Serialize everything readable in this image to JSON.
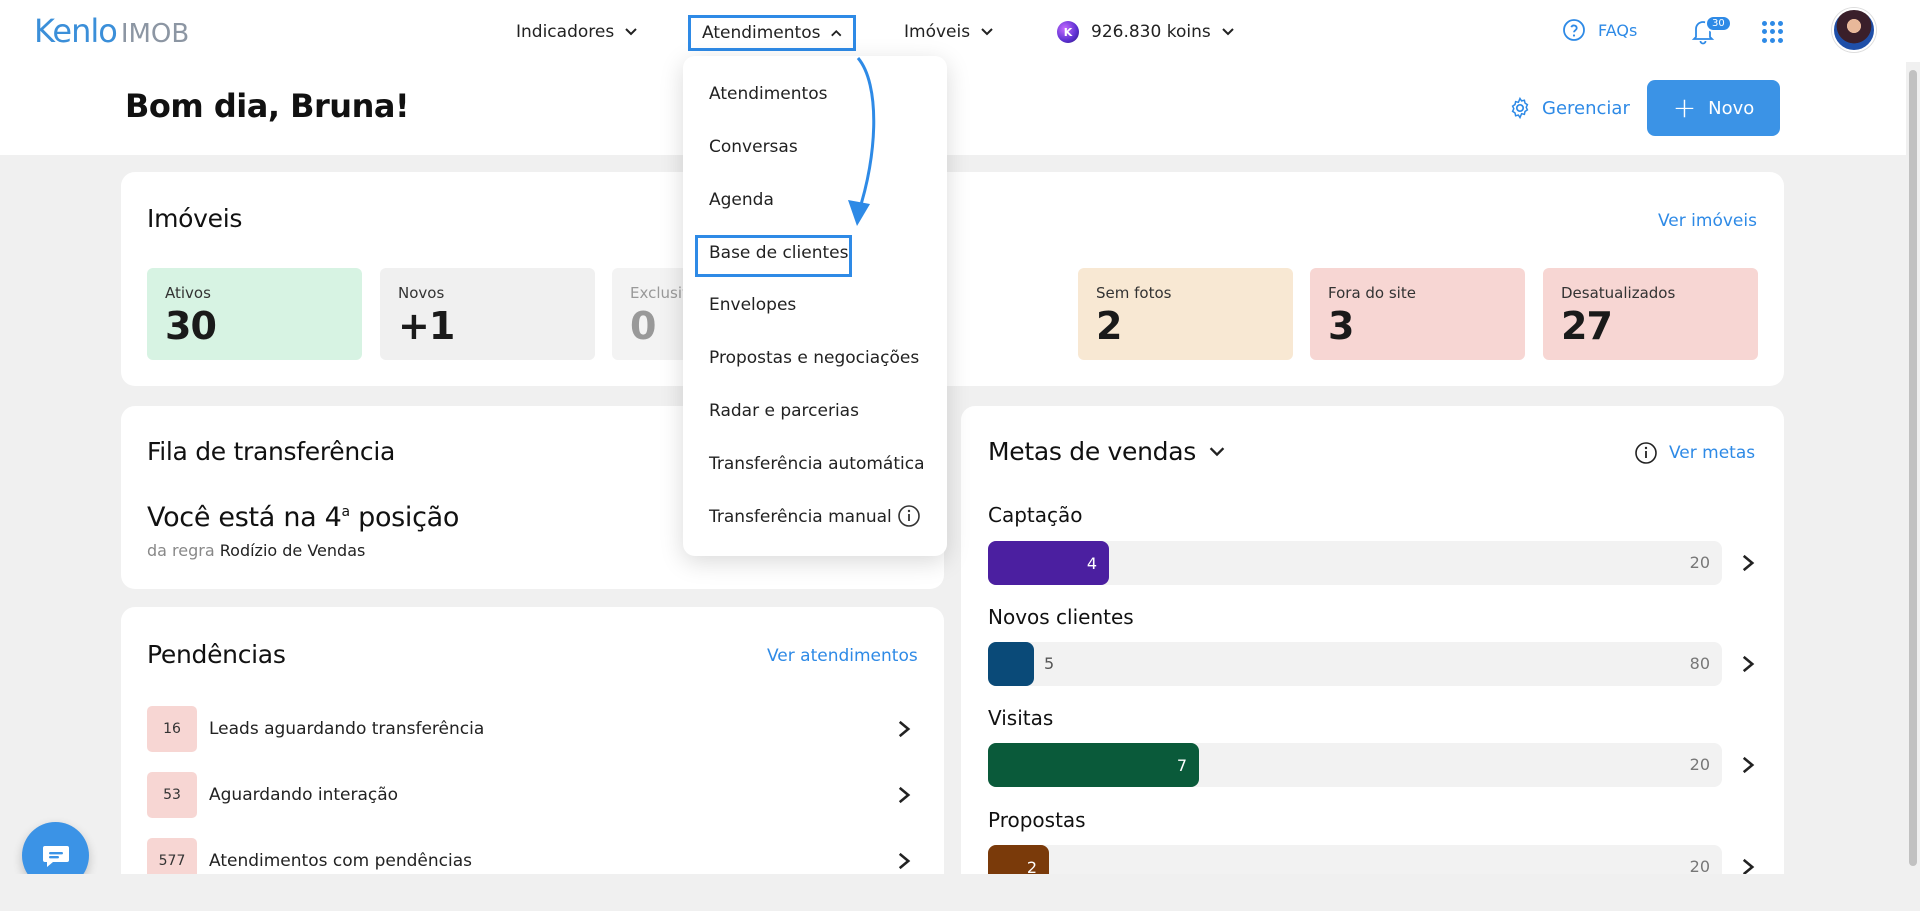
{
  "header": {
    "logo_main": "Kenlo",
    "logo_sub": "IMOB",
    "nav": {
      "indicadores": "Indicadores",
      "atendimentos": "Atendimentos",
      "imoveis": "Imóveis",
      "koins": "926.830 koins"
    },
    "faqs": "FAQs",
    "notifications_count": "30"
  },
  "greeting": "Bom dia, Bruna!",
  "actions": {
    "gerenciar": "Gerenciar",
    "novo": "Novo"
  },
  "imoveis": {
    "title": "Imóveis",
    "link": "Ver imóveis",
    "stats": [
      {
        "label": "Ativos",
        "value": "30",
        "bg": "#d7f3e3"
      },
      {
        "label": "Novos",
        "value": "+1",
        "bg": "#f0f0f0"
      },
      {
        "label": "Exclusivo",
        "value": "0",
        "bg": "#f3f3f3"
      },
      {
        "label": "Sem fotos",
        "value": "2",
        "bg": "#f8e8d3"
      },
      {
        "label": "Fora do site",
        "value": "3",
        "bg": "#f7d6d3"
      },
      {
        "label": "Desatualizados",
        "value": "27",
        "bg": "#f7d6d3"
      }
    ]
  },
  "fila": {
    "title": "Fila de transferência",
    "position_prefix": "Você está na 4",
    "position_sup": "a",
    "position_suffix": " posição",
    "rule_prefix": "da regra ",
    "rule_name": "Rodízio de Vendas"
  },
  "pendencias": {
    "title": "Pendências",
    "link": "Ver atendimentos",
    "rows": [
      {
        "count": "16",
        "label": "Leads aguardando transferência"
      },
      {
        "count": "53",
        "label": "Aguardando interação"
      },
      {
        "count": "577",
        "label": "Atendimentos com pendências"
      }
    ]
  },
  "metas": {
    "title": "Metas de vendas",
    "link": "Ver metas",
    "items": [
      {
        "label": "Captação",
        "value": 4,
        "value_text": "4",
        "total": "20",
        "color": "#4b1fa0",
        "fraction": 0.165
      },
      {
        "label": "Novos clientes",
        "value": 5,
        "value_text": "5",
        "total": "80",
        "color": "#0a4a78",
        "fraction": 0.062
      },
      {
        "label": "Visitas",
        "value": 7,
        "value_text": "7",
        "total": "20",
        "color": "#0a5a3a",
        "fraction": 0.287
      },
      {
        "label": "Propostas",
        "value": 2,
        "value_text": "2",
        "total": "20",
        "color": "#7a3a0a",
        "fraction": 0.083
      }
    ]
  },
  "dropdown": {
    "items": [
      "Atendimentos",
      "Conversas",
      "Agenda",
      "Base de clientes",
      "Envelopes",
      "Propostas e negociações",
      "Radar e parcerias",
      "Transferência automática",
      "Transferência manual"
    ]
  },
  "colors": {
    "accent": "#2e8ae6"
  }
}
